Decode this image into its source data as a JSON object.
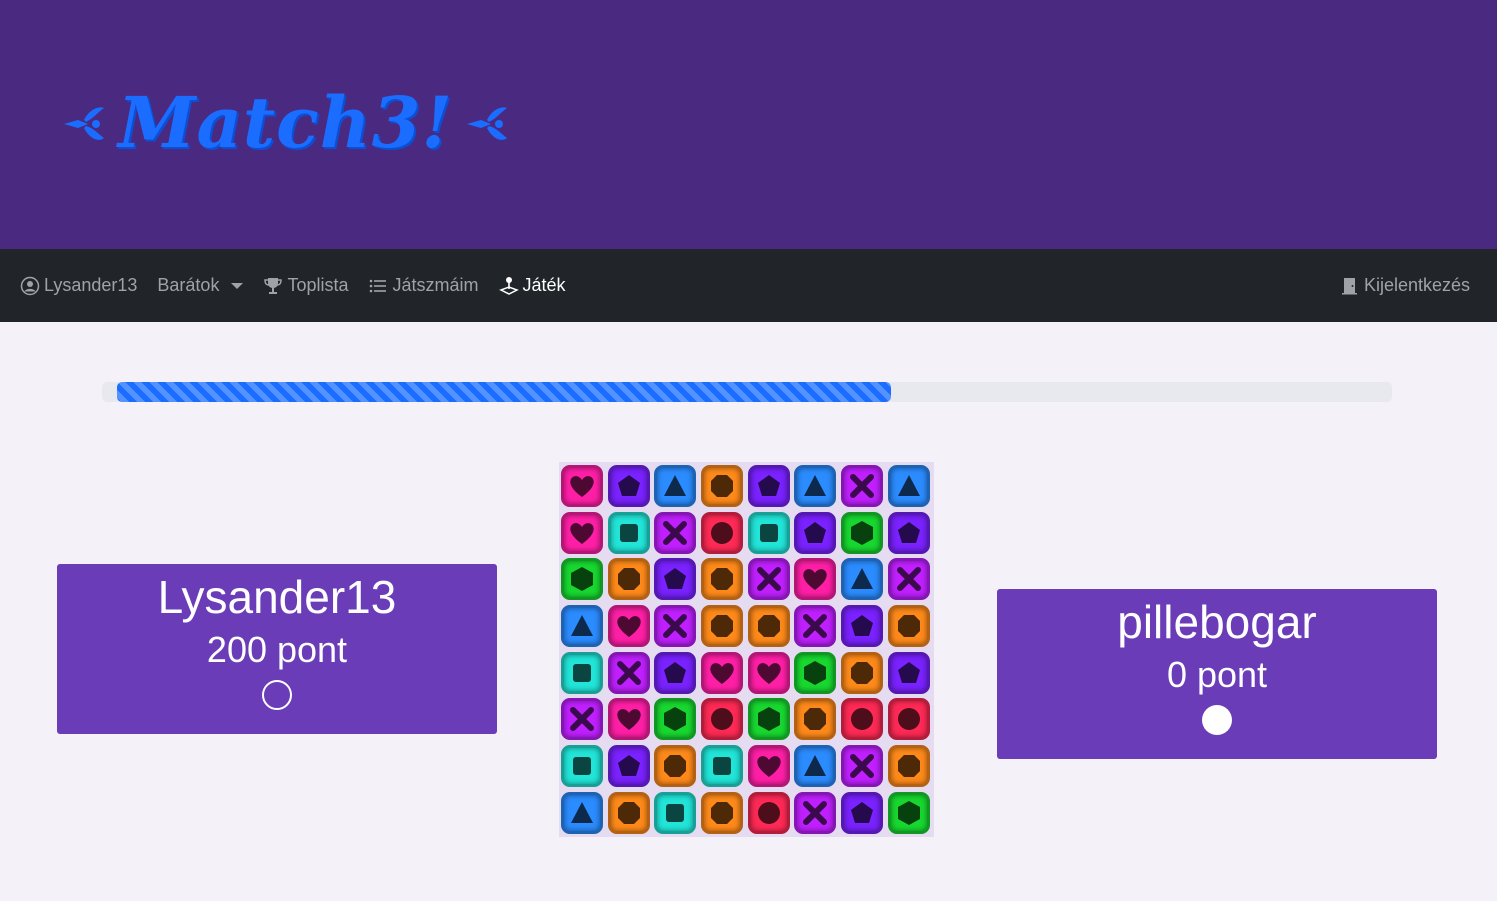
{
  "app": {
    "logo_text": "Match3!"
  },
  "nav": {
    "items": [
      {
        "id": "profile",
        "label": "Lysander13",
        "icon": "user-circle-icon",
        "active": false
      },
      {
        "id": "friends",
        "label": "Barátok",
        "icon": "none",
        "active": false,
        "dropdown": true
      },
      {
        "id": "toplist",
        "label": "Toplista",
        "icon": "trophy-icon",
        "active": false
      },
      {
        "id": "games",
        "label": "Játszmáim",
        "icon": "list-icon",
        "active": false
      },
      {
        "id": "play",
        "label": "Játék",
        "icon": "joystick-icon",
        "active": true
      }
    ],
    "logout": {
      "label": "Kijelentkezés",
      "icon": "door-icon"
    }
  },
  "progress": {
    "percent": 60
  },
  "players": {
    "left": {
      "name": "Lysander13",
      "score_text": "200 pont",
      "turn": false
    },
    "right": {
      "name": "pillebogar",
      "score_text": "0 pont",
      "turn": true
    }
  },
  "board": {
    "rows": [
      [
        "heart",
        "pentagon",
        "triangle",
        "octagon",
        "pentagon",
        "triangle",
        "cross",
        "triangle"
      ],
      [
        "heart",
        "square",
        "cross",
        "circle",
        "square",
        "pentagon",
        "hexagon",
        "pentagon"
      ],
      [
        "hexagon",
        "octagon",
        "pentagon",
        "octagon",
        "cross",
        "heart",
        "triangle",
        "cross"
      ],
      [
        "triangle",
        "heart",
        "cross",
        "octagon",
        "octagon",
        "cross",
        "pentagon",
        "octagon"
      ],
      [
        "square",
        "cross",
        "pentagon",
        "heart",
        "heart",
        "hexagon",
        "octagon",
        "pentagon"
      ],
      [
        "cross",
        "heart",
        "hexagon",
        "circle",
        "hexagon",
        "octagon",
        "circle",
        "circle"
      ],
      [
        "square",
        "pentagon",
        "octagon",
        "square",
        "heart",
        "triangle",
        "cross",
        "octagon"
      ],
      [
        "triangle",
        "octagon",
        "square",
        "octagon",
        "circle",
        "cross",
        "pentagon",
        "hexagon"
      ]
    ]
  },
  "colors": {
    "hero_bg": "#4a2a81",
    "navbar_bg": "#212529",
    "accent": "#1a6dff",
    "card_bg": "#6a3cb8",
    "heart": "#ff1fa6",
    "pentagon": "#7a22ff",
    "triangle": "#2b8cff",
    "octagon": "#ff8a1a",
    "cross": "#c020ff",
    "square": "#22e5d8",
    "circle": "#ff2a55",
    "hexagon": "#18d830"
  }
}
